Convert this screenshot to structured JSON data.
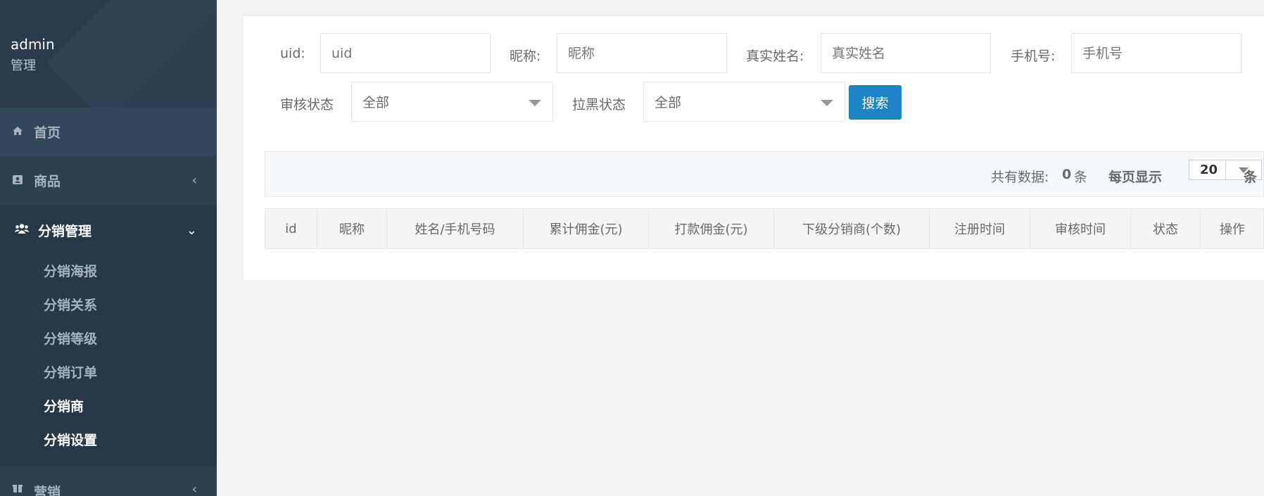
{
  "sidebar": {
    "user_name": "admin",
    "user_role": "管理",
    "items": [
      {
        "label": "首页",
        "icon": "home-icon"
      },
      {
        "label": "商品",
        "icon": "id-card-icon"
      },
      {
        "label": "分销管理",
        "icon": "users-icon"
      },
      {
        "label": "营销",
        "icon": "gift-icon"
      }
    ],
    "sub_items": [
      {
        "label": "分销海报"
      },
      {
        "label": "分销关系"
      },
      {
        "label": "分销等级"
      },
      {
        "label": "分销订单"
      },
      {
        "label": "分销商"
      },
      {
        "label": "分销设置"
      }
    ]
  },
  "filters": {
    "uid_label": "uid:",
    "uid_placeholder": "uid",
    "nickname_label": "昵称:",
    "nickname_placeholder": "昵称",
    "realname_label": "真实姓名:",
    "realname_placeholder": "真实姓名",
    "phone_label": "手机号:",
    "phone_placeholder": "手机号",
    "audit_label": "审核状态",
    "audit_value": "全部",
    "blacklist_label": "拉黑状态",
    "blacklist_value": "全部",
    "search_button": "搜索"
  },
  "info": {
    "total_label": "共有数据:",
    "total_count": "0",
    "total_unit": "条",
    "per_page_label": "每页显示",
    "per_page_value": "20",
    "per_page_unit": "条"
  },
  "table": {
    "headers": [
      "id",
      "昵称",
      "姓名/手机号码",
      "累计佣金(元)",
      "打款佣金(元)",
      "下级分销商(个数)",
      "注册时间",
      "审核时间",
      "状态",
      "操作"
    ]
  },
  "colors": {
    "sidebar_bg": "#2f4050",
    "primary_button": "#1c84c6"
  }
}
